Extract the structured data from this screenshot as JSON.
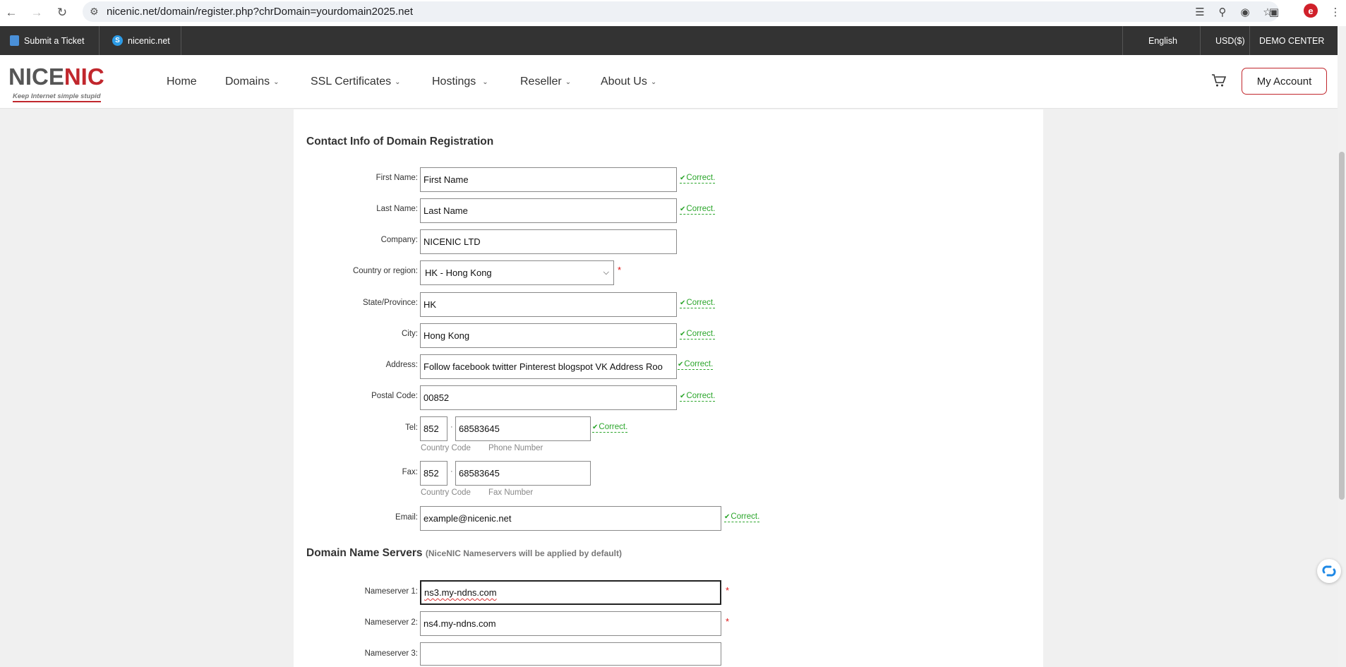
{
  "browser": {
    "url": "nicenic.net/domain/register.php?chrDomain=yourdomain2025.net"
  },
  "topbar": {
    "submit_ticket": "Submit a Ticket",
    "skype": "nicenic.net",
    "language": "English",
    "currency": "USD($)",
    "demo": "DEMO CENTER"
  },
  "logo": {
    "text_a": "NICE",
    "text_b": "NIC",
    "tagline": "Keep Internet simple stupid"
  },
  "nav": {
    "home": "Home",
    "domains": "Domains",
    "ssl": "SSL Certificates",
    "hostings": "Hostings",
    "reseller": "Reseller",
    "about": "About Us",
    "account": "My Account"
  },
  "contact": {
    "title": "Contact Info of Domain Registration",
    "correct": "Correct.",
    "first_name_label": "First Name:",
    "first_name": "First Name",
    "last_name_label": "Last Name:",
    "last_name": "Last Name",
    "company_label": "Company:",
    "company": "NICENIC LTD",
    "country_label": "Country or region:",
    "country": "HK - Hong Kong",
    "state_label": "State/Province:",
    "state": "HK",
    "city_label": "City:",
    "city": "Hong Kong",
    "address_label": "Address:",
    "address": "Follow facebook twitter Pinterest blogspot VK Address Roo",
    "postal_label": "Postal Code:",
    "postal": "00852",
    "tel_label": "Tel:",
    "tel_cc": "852",
    "tel_num": "68583645",
    "tel_cc_hint": "Country Code",
    "tel_num_hint": "Phone Number",
    "fax_label": "Fax:",
    "fax_cc": "852",
    "fax_num": "68583645",
    "fax_cc_hint": "Country Code",
    "fax_num_hint": "Fax Number",
    "email_label": "Email:",
    "email": "example@nicenic.net",
    "required_mark": "*",
    "dot": "·"
  },
  "dns": {
    "title": "Domain Name Servers",
    "note": "(NiceNIC Nameservers will be applied by default)",
    "ns1_label": "Nameserver 1:",
    "ns1": "ns3.my-ndns.com",
    "ns2_label": "Nameserver 2:",
    "ns2": "ns4.my-ndns.com",
    "ns3_label": "Nameserver 3:",
    "ns3": ""
  }
}
